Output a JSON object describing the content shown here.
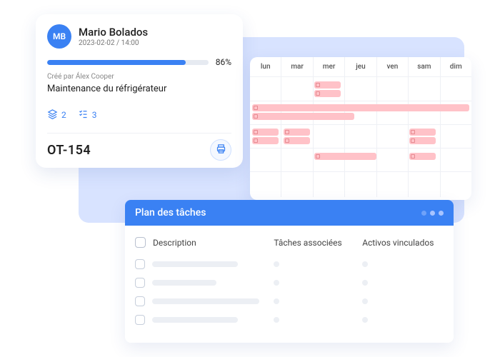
{
  "work_order": {
    "avatar_initials": "MB",
    "name": "Mario Bolados",
    "datetime": "2023-02-02 / 14:00",
    "progress_pct": 86,
    "progress_label": "86%",
    "created_by_label": "Créé par Álex Cooper",
    "title": "Maintenance du réfrigérateur",
    "layers_count": "2",
    "checklist_count": "3",
    "id": "OT-154"
  },
  "calendar": {
    "days": [
      "lun",
      "mar",
      "mer",
      "jeu",
      "ven",
      "sam",
      "dim"
    ]
  },
  "task_plan": {
    "title": "Plan des tâches",
    "columns": {
      "description": "Description",
      "assoc": "Tâches associées",
      "assets": "Activos vinculados"
    }
  }
}
